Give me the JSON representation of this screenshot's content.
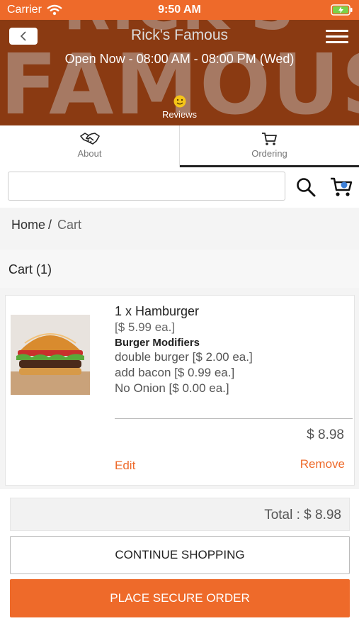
{
  "status_bar": {
    "carrier": "Carrier",
    "time": "9:50 AM"
  },
  "header": {
    "title": "Rick's Famous",
    "hours": "Open Now - 08:00 AM - 08:00 PM (Wed)",
    "reviews_label": "Reviews",
    "background_text_top": "RICK'S",
    "background_text_bottom": "FAMOUS"
  },
  "tabs": [
    {
      "label": "About",
      "icon": "handshake-icon"
    },
    {
      "label": "Ordering",
      "icon": "cart-icon",
      "active": true
    }
  ],
  "search": {
    "value": "",
    "placeholder": ""
  },
  "breadcrumb": {
    "home": "Home",
    "separator": "/",
    "current": "Cart"
  },
  "cart": {
    "title": "Cart (1)",
    "items": [
      {
        "name": "1 x Hamburger",
        "unit_price": "[$ 5.99 ea.]",
        "modifier_heading": "Burger Modifiers",
        "modifiers": [
          "double burger [$ 2.00 ea.]",
          "add bacon [$ 0.99 ea.]",
          "No Onion [$ 0.00 ea.]"
        ],
        "subtotal": "$ 8.98",
        "edit_label": "Edit",
        "remove_label": "Remove"
      }
    ],
    "total": "Total : $ 8.98"
  },
  "actions": {
    "continue_label": "CONTINUE SHOPPING",
    "order_label": "PLACE SECURE ORDER"
  },
  "colors": {
    "accent": "#ee6a2a",
    "hero_background": "#8a3a12",
    "status_bar": "#ee6a2a"
  }
}
